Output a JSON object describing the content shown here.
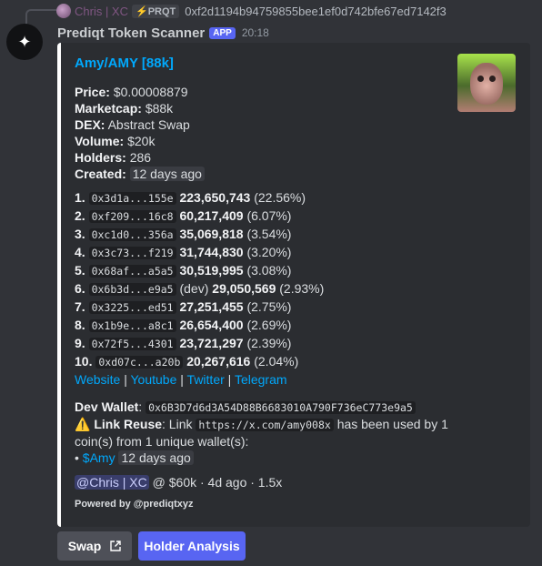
{
  "reply": {
    "user": "Chris | XC",
    "tag": "⚡PRQT",
    "text": "0xf2d1194b94759855bee1ef0d742bfe67ed7142f3"
  },
  "header": {
    "bot_name": "Prediqt Token Scanner",
    "badge": "APP",
    "time": "20:18"
  },
  "embed": {
    "title": "Amy/AMY [88k]",
    "fields": [
      {
        "label": "Price:",
        "value": "$0.00008879"
      },
      {
        "label": "Marketcap:",
        "value": "$88k"
      },
      {
        "label": "DEX:",
        "value": "Abstract Swap"
      },
      {
        "label": "Volume:",
        "value": "$20k"
      },
      {
        "label": "Holders:",
        "value": "286"
      },
      {
        "label": "Created:",
        "value": "12 days ago"
      }
    ],
    "holders": [
      {
        "rank": "1.",
        "addr": "0x3d1a...155e",
        "dev": "",
        "amount": "223,650,743",
        "pct": "(22.56%)"
      },
      {
        "rank": "2.",
        "addr": "0xf209...16c8",
        "dev": "",
        "amount": "60,217,409",
        "pct": "(6.07%)"
      },
      {
        "rank": "3.",
        "addr": "0xc1d0...356a",
        "dev": "",
        "amount": "35,069,818",
        "pct": "(3.54%)"
      },
      {
        "rank": "4.",
        "addr": "0x3c73...f219",
        "dev": "",
        "amount": "31,744,830",
        "pct": "(3.20%)"
      },
      {
        "rank": "5.",
        "addr": "0x68af...a5a5",
        "dev": "",
        "amount": "30,519,995",
        "pct": "(3.08%)"
      },
      {
        "rank": "6.",
        "addr": "0x6b3d...e9a5",
        "dev": "(dev)",
        "amount": "29,050,569",
        "pct": "(2.93%)"
      },
      {
        "rank": "7.",
        "addr": "0x3225...ed51",
        "dev": "",
        "amount": "27,251,455",
        "pct": "(2.75%)"
      },
      {
        "rank": "8.",
        "addr": "0x1b9e...a8c1",
        "dev": "",
        "amount": "26,654,400",
        "pct": "(2.69%)"
      },
      {
        "rank": "9.",
        "addr": "0x72f5...4301",
        "dev": "",
        "amount": "23,721,297",
        "pct": "(2.39%)"
      },
      {
        "rank": "10.",
        "addr": "0xd07c...a20b",
        "dev": "",
        "amount": "20,267,616",
        "pct": "(2.04%)"
      }
    ],
    "links": [
      "Website",
      "Youtube",
      "Twitter",
      "Telegram"
    ],
    "separator": "|",
    "dev_wallet_label": "Dev Wallet",
    "dev_wallet": "0x6B3D7d6d3A54D88B6683010A790F736eC773e9a5",
    "warn_icon": "⚠️",
    "link_reuse_label": "Link Reuse",
    "link_reuse_prefix": ": Link",
    "link_reuse_url": "https://x.com/amy008x",
    "link_reuse_suffix": "has been used by 1 coin(s) from 1 unique wallet(s):",
    "bullet": "•",
    "reuse_coin": "$Amy",
    "reuse_age": "12 days ago",
    "footer_mention": "@Chris | XC",
    "footer_rest": "@ $60k · 4d ago · 1.5x",
    "powered": "Powered by @prediqtxyz"
  },
  "buttons": {
    "swap": "Swap",
    "holder_analysis": "Holder Analysis"
  },
  "colors": {
    "background": "#313338",
    "embed_bg": "#2b2d31",
    "accent": "#5865f2",
    "link": "#00a8fc"
  }
}
